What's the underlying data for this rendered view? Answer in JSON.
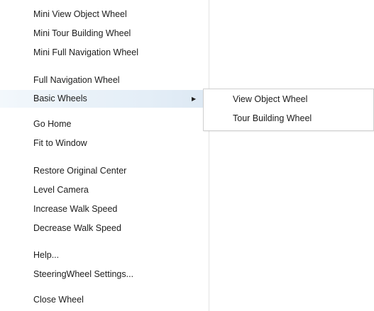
{
  "menu": {
    "items": [
      {
        "label": "Mini View Object Wheel"
      },
      {
        "label": "Mini Tour Building Wheel"
      },
      {
        "label": "Mini Full Navigation Wheel"
      },
      {
        "label": "Full Navigation Wheel"
      },
      {
        "label": "Basic Wheels",
        "has_submenu": true,
        "highlighted": true
      },
      {
        "label": "Go Home"
      },
      {
        "label": "Fit to Window"
      },
      {
        "label": "Restore Original Center"
      },
      {
        "label": "Level Camera"
      },
      {
        "label": "Increase Walk Speed"
      },
      {
        "label": "Decrease Walk Speed"
      },
      {
        "label": "Help..."
      },
      {
        "label": "SteeringWheel Settings..."
      },
      {
        "label": "Close Wheel"
      }
    ]
  },
  "submenu": {
    "items": [
      {
        "label": "View Object Wheel"
      },
      {
        "label": "Tour Building Wheel"
      }
    ]
  },
  "icons": {
    "submenu_arrow": "triangle-right-icon",
    "submenu_arrow_glyph": "▶"
  },
  "colors": {
    "highlight": "#e4eef7",
    "text": "#1c1c1c",
    "border": "#cfcfcf"
  }
}
